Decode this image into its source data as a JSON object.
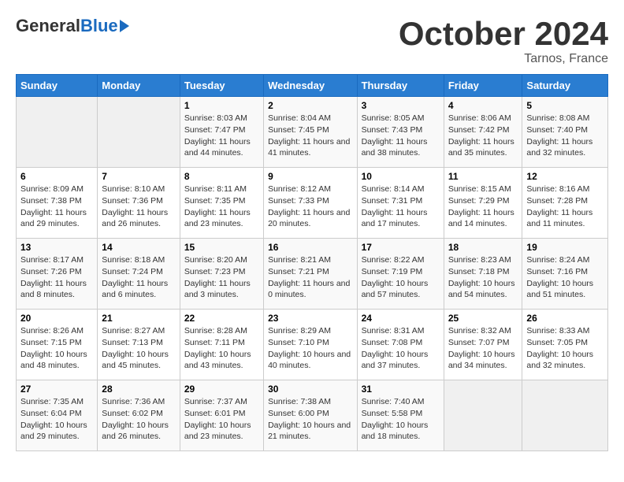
{
  "header": {
    "logo_general": "General",
    "logo_blue": "Blue",
    "month_title": "October 2024",
    "subtitle": "Tarnos, France"
  },
  "days_of_week": [
    "Sunday",
    "Monday",
    "Tuesday",
    "Wednesday",
    "Thursday",
    "Friday",
    "Saturday"
  ],
  "weeks": [
    [
      {
        "day": "",
        "sunrise": "",
        "sunset": "",
        "daylight": ""
      },
      {
        "day": "",
        "sunrise": "",
        "sunset": "",
        "daylight": ""
      },
      {
        "day": "1",
        "sunrise": "Sunrise: 8:03 AM",
        "sunset": "Sunset: 7:47 PM",
        "daylight": "Daylight: 11 hours and 44 minutes."
      },
      {
        "day": "2",
        "sunrise": "Sunrise: 8:04 AM",
        "sunset": "Sunset: 7:45 PM",
        "daylight": "Daylight: 11 hours and 41 minutes."
      },
      {
        "day": "3",
        "sunrise": "Sunrise: 8:05 AM",
        "sunset": "Sunset: 7:43 PM",
        "daylight": "Daylight: 11 hours and 38 minutes."
      },
      {
        "day": "4",
        "sunrise": "Sunrise: 8:06 AM",
        "sunset": "Sunset: 7:42 PM",
        "daylight": "Daylight: 11 hours and 35 minutes."
      },
      {
        "day": "5",
        "sunrise": "Sunrise: 8:08 AM",
        "sunset": "Sunset: 7:40 PM",
        "daylight": "Daylight: 11 hours and 32 minutes."
      }
    ],
    [
      {
        "day": "6",
        "sunrise": "Sunrise: 8:09 AM",
        "sunset": "Sunset: 7:38 PM",
        "daylight": "Daylight: 11 hours and 29 minutes."
      },
      {
        "day": "7",
        "sunrise": "Sunrise: 8:10 AM",
        "sunset": "Sunset: 7:36 PM",
        "daylight": "Daylight: 11 hours and 26 minutes."
      },
      {
        "day": "8",
        "sunrise": "Sunrise: 8:11 AM",
        "sunset": "Sunset: 7:35 PM",
        "daylight": "Daylight: 11 hours and 23 minutes."
      },
      {
        "day": "9",
        "sunrise": "Sunrise: 8:12 AM",
        "sunset": "Sunset: 7:33 PM",
        "daylight": "Daylight: 11 hours and 20 minutes."
      },
      {
        "day": "10",
        "sunrise": "Sunrise: 8:14 AM",
        "sunset": "Sunset: 7:31 PM",
        "daylight": "Daylight: 11 hours and 17 minutes."
      },
      {
        "day": "11",
        "sunrise": "Sunrise: 8:15 AM",
        "sunset": "Sunset: 7:29 PM",
        "daylight": "Daylight: 11 hours and 14 minutes."
      },
      {
        "day": "12",
        "sunrise": "Sunrise: 8:16 AM",
        "sunset": "Sunset: 7:28 PM",
        "daylight": "Daylight: 11 hours and 11 minutes."
      }
    ],
    [
      {
        "day": "13",
        "sunrise": "Sunrise: 8:17 AM",
        "sunset": "Sunset: 7:26 PM",
        "daylight": "Daylight: 11 hours and 8 minutes."
      },
      {
        "day": "14",
        "sunrise": "Sunrise: 8:18 AM",
        "sunset": "Sunset: 7:24 PM",
        "daylight": "Daylight: 11 hours and 6 minutes."
      },
      {
        "day": "15",
        "sunrise": "Sunrise: 8:20 AM",
        "sunset": "Sunset: 7:23 PM",
        "daylight": "Daylight: 11 hours and 3 minutes."
      },
      {
        "day": "16",
        "sunrise": "Sunrise: 8:21 AM",
        "sunset": "Sunset: 7:21 PM",
        "daylight": "Daylight: 11 hours and 0 minutes."
      },
      {
        "day": "17",
        "sunrise": "Sunrise: 8:22 AM",
        "sunset": "Sunset: 7:19 PM",
        "daylight": "Daylight: 10 hours and 57 minutes."
      },
      {
        "day": "18",
        "sunrise": "Sunrise: 8:23 AM",
        "sunset": "Sunset: 7:18 PM",
        "daylight": "Daylight: 10 hours and 54 minutes."
      },
      {
        "day": "19",
        "sunrise": "Sunrise: 8:24 AM",
        "sunset": "Sunset: 7:16 PM",
        "daylight": "Daylight: 10 hours and 51 minutes."
      }
    ],
    [
      {
        "day": "20",
        "sunrise": "Sunrise: 8:26 AM",
        "sunset": "Sunset: 7:15 PM",
        "daylight": "Daylight: 10 hours and 48 minutes."
      },
      {
        "day": "21",
        "sunrise": "Sunrise: 8:27 AM",
        "sunset": "Sunset: 7:13 PM",
        "daylight": "Daylight: 10 hours and 45 minutes."
      },
      {
        "day": "22",
        "sunrise": "Sunrise: 8:28 AM",
        "sunset": "Sunset: 7:11 PM",
        "daylight": "Daylight: 10 hours and 43 minutes."
      },
      {
        "day": "23",
        "sunrise": "Sunrise: 8:29 AM",
        "sunset": "Sunset: 7:10 PM",
        "daylight": "Daylight: 10 hours and 40 minutes."
      },
      {
        "day": "24",
        "sunrise": "Sunrise: 8:31 AM",
        "sunset": "Sunset: 7:08 PM",
        "daylight": "Daylight: 10 hours and 37 minutes."
      },
      {
        "day": "25",
        "sunrise": "Sunrise: 8:32 AM",
        "sunset": "Sunset: 7:07 PM",
        "daylight": "Daylight: 10 hours and 34 minutes."
      },
      {
        "day": "26",
        "sunrise": "Sunrise: 8:33 AM",
        "sunset": "Sunset: 7:05 PM",
        "daylight": "Daylight: 10 hours and 32 minutes."
      }
    ],
    [
      {
        "day": "27",
        "sunrise": "Sunrise: 7:35 AM",
        "sunset": "Sunset: 6:04 PM",
        "daylight": "Daylight: 10 hours and 29 minutes."
      },
      {
        "day": "28",
        "sunrise": "Sunrise: 7:36 AM",
        "sunset": "Sunset: 6:02 PM",
        "daylight": "Daylight: 10 hours and 26 minutes."
      },
      {
        "day": "29",
        "sunrise": "Sunrise: 7:37 AM",
        "sunset": "Sunset: 6:01 PM",
        "daylight": "Daylight: 10 hours and 23 minutes."
      },
      {
        "day": "30",
        "sunrise": "Sunrise: 7:38 AM",
        "sunset": "Sunset: 6:00 PM",
        "daylight": "Daylight: 10 hours and 21 minutes."
      },
      {
        "day": "31",
        "sunrise": "Sunrise: 7:40 AM",
        "sunset": "Sunset: 5:58 PM",
        "daylight": "Daylight: 10 hours and 18 minutes."
      },
      {
        "day": "",
        "sunrise": "",
        "sunset": "",
        "daylight": ""
      },
      {
        "day": "",
        "sunrise": "",
        "sunset": "",
        "daylight": ""
      }
    ]
  ]
}
